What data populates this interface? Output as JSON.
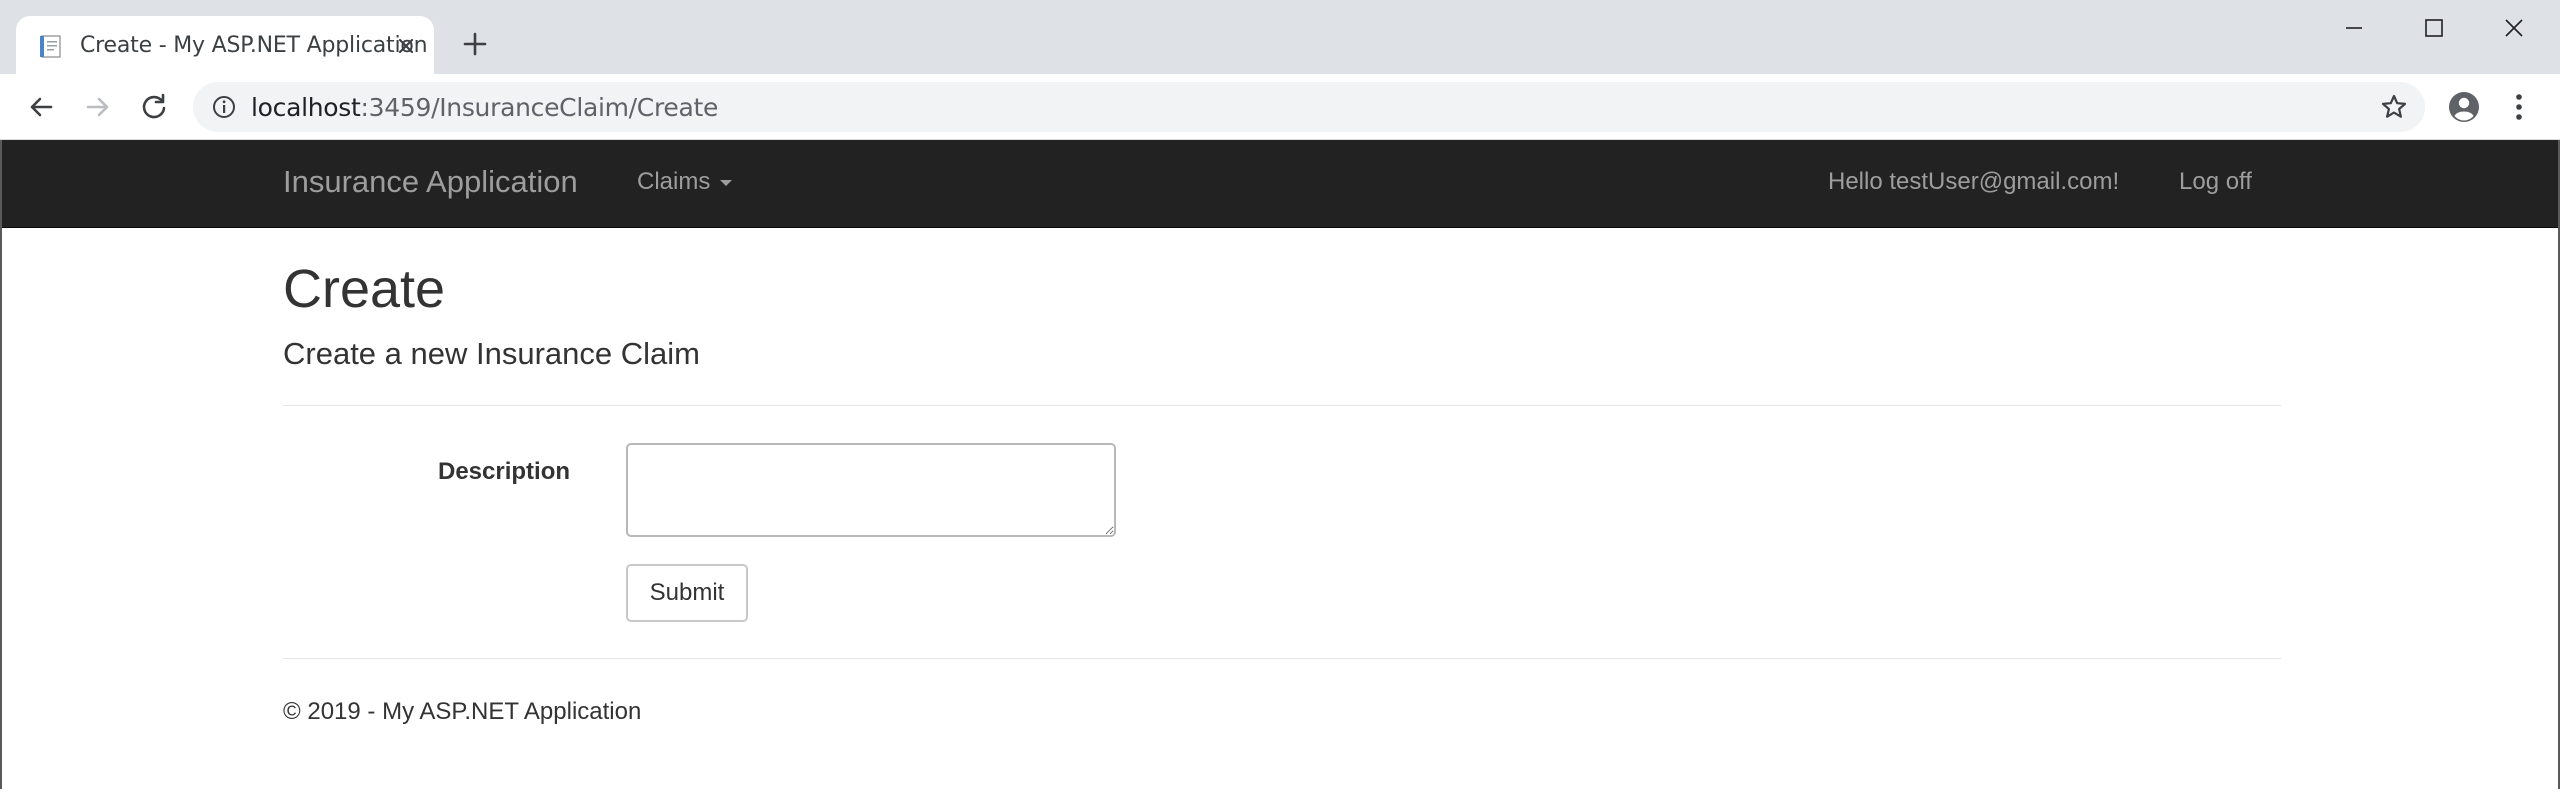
{
  "browser": {
    "tab_title": "Create - My ASP.NET Application",
    "url_host": "localhost",
    "url_path": ":3459/InsuranceClaim/Create",
    "icons": [
      "page-favicon-icon",
      "close-icon",
      "plus-icon",
      "minimize-icon",
      "maximize-icon",
      "close-icon",
      "arrow-left-icon",
      "arrow-right-icon",
      "reload-icon",
      "info-icon",
      "star-icon",
      "account-icon",
      "kebab-menu-icon"
    ]
  },
  "navbar": {
    "brand": "Insurance Application",
    "claims_label": "Claims",
    "greeting": "Hello testUser@gmail.com!",
    "logoff_label": "Log off",
    "background": "#222222",
    "text_color": "#9d9d9d"
  },
  "page": {
    "title": "Create",
    "subtitle": "Create a new Insurance Claim"
  },
  "form": {
    "description_label": "Description",
    "description_value": "",
    "submit_label": "Submit"
  },
  "footer": {
    "text": "© 2019 - My ASP.NET Application"
  }
}
